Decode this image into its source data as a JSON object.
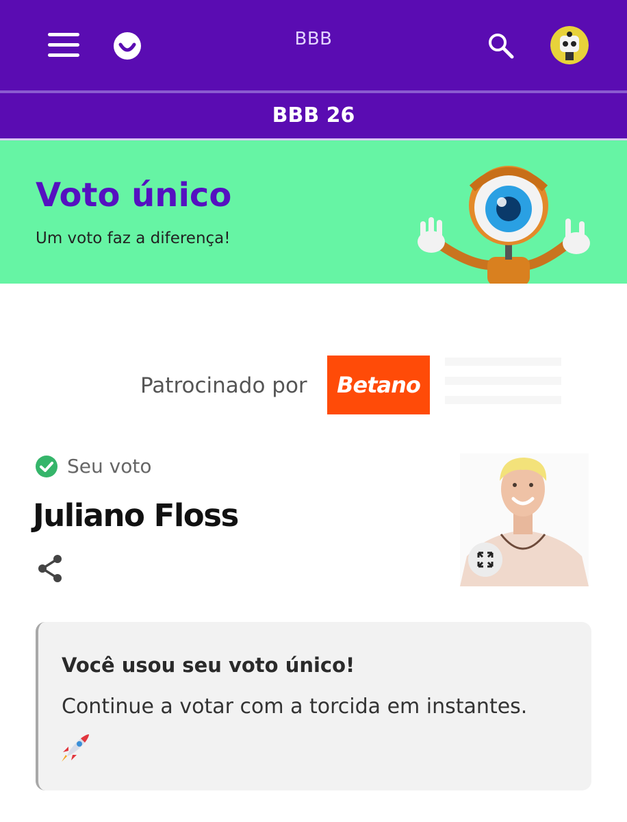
{
  "header": {
    "site_title": "BBB",
    "section_title": "BBB 26",
    "icons": [
      "menu-icon",
      "smile-logo-icon",
      "search-icon",
      "avatar-icon"
    ]
  },
  "hero": {
    "title": "Voto único",
    "subtitle": "Um voto faz a diferença!",
    "background_color": "#66f4a4",
    "title_color": "#5511c0"
  },
  "sponsor": {
    "label": "Patrocinado por",
    "logo_text": "Betano",
    "logo_color": "#ff4b08"
  },
  "vote": {
    "status_label": "Seu voto",
    "candidate_name": "Juliano Floss"
  },
  "notice": {
    "title": "Você usou seu voto único!",
    "body": "Continue a votar com a torcida em instantes.",
    "emoji": "rocket-icon"
  },
  "colors": {
    "brand_purple": "#5a0cb2",
    "check_green": "#35b56a"
  }
}
